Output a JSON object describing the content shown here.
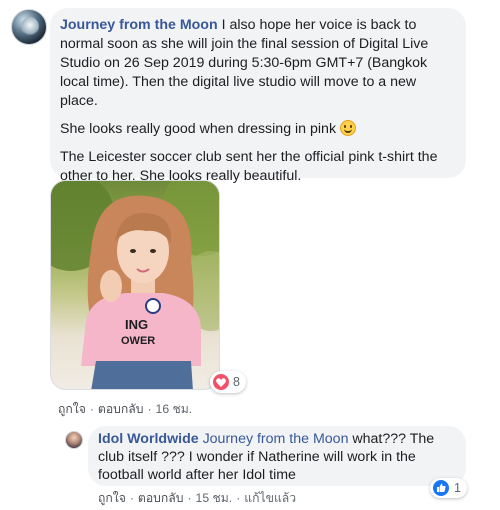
{
  "comment": {
    "author": "Journey from the Moon",
    "para1": " I also hope her voice is back to normal soon as she will join the final session of Digital Live Studio on 26 Sep 2019 during 5:30-6pm GMT+7 (Bangkok local time). Then the digital live studio will move to a new place.",
    "para2": "She looks really good when dressing in pink ",
    "para3": "The Leicester soccer club sent her the official pink t-shirt the other to her. She looks really beautiful.",
    "reaction_count": "8",
    "actions": {
      "like": "ถูกใจ",
      "reply": "ตอบกลับ",
      "time": "16 ชม."
    },
    "photo_shirt_text1": "ING",
    "photo_shirt_text2": "OWER"
  },
  "reply": {
    "author": "Idol Worldwide",
    "mention": "Journey from the Moon",
    "text": " what??? The club itself ??? I wonder if Natherine will work in the football world after her Idol time",
    "reaction_count": "1",
    "actions": {
      "like": "ถูกใจ",
      "reply": "ตอบกลับ",
      "time": "15 ชม.",
      "edited": "แก้ไขแล้ว"
    }
  },
  "icons": {
    "reaction_main": "love-icon",
    "reaction_reply": "like-icon",
    "emoji": "smile-emoji-icon"
  },
  "colors": {
    "link": "#385898",
    "bubble": "#f2f3f5",
    "love": "#f25268",
    "like": "#1877f2"
  }
}
